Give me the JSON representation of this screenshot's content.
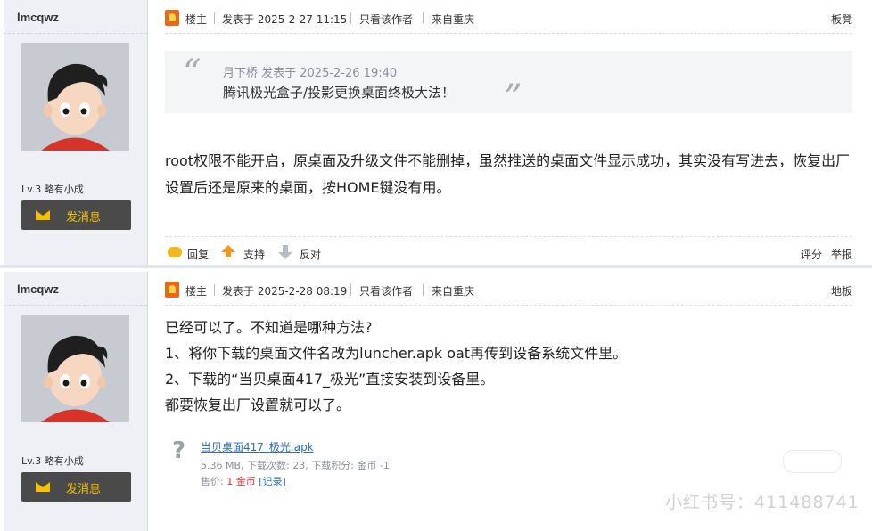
{
  "posts": [
    {
      "author": "lmcqwz",
      "level": "Lv.3 略有小成",
      "message_button": "发消息",
      "role": "楼主",
      "posted": "发表于 2025-2-27 11:15",
      "only_author": "只看该作者",
      "location": "来自重庆",
      "floor": "板凳",
      "quote": {
        "meta": "月下桥 发表于 2025-2-26 19:40",
        "text": "腾讯极光盒子/投影更换桌面终极大法！"
      },
      "body": "root权限不能开启，原桌面及升级文件不能删掉，虽然推送的桌面文件显示成功，其实没有写进去，恢复出厂设置后还是原来的桌面，按HOME键没有用。",
      "actions": {
        "reply": "回复",
        "support": "支持",
        "oppose": "反对",
        "rate": "评分",
        "report": "举报"
      }
    },
    {
      "author": "lmcqwz",
      "level": "Lv.3 略有小成",
      "message_button": "发消息",
      "role": "楼主",
      "posted": "发表于 2025-2-28 08:19",
      "only_author": "只看该作者",
      "location": "来自重庆",
      "floor": "地板",
      "body_lines": [
        "已经可以了。不知道是哪种方法?",
        "1、将你下载的桌面文件名改为luncher.apk  oat再传到设备系统文件里。",
        "2、下载的“当贝桌面417_极光”直接安装到设备里。",
        "都要恢复出厂设置就可以了。"
      ],
      "attachment": {
        "name": "当贝桌面417_极光.apk",
        "meta": "5.36 MB, 下载次数: 23, 下载积分: 金币 -1",
        "price_label": "售价: ",
        "price_value": "1 金币",
        "record": "[记录]"
      }
    }
  ],
  "watermark": "小红书号：411488741"
}
